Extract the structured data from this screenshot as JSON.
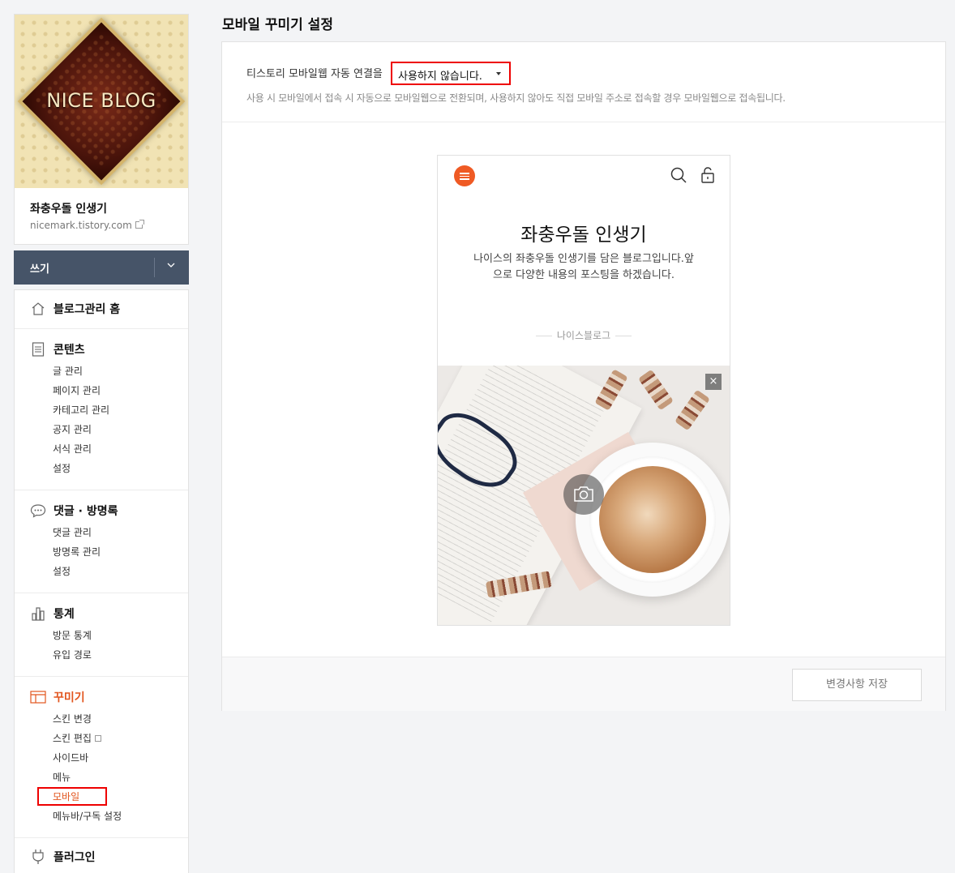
{
  "profile": {
    "logo_text": "NICE BLOG",
    "blog_name": "좌충우돌 인생기",
    "blog_url": "nicemark.tistory.com"
  },
  "write_button": {
    "label": "쓰기"
  },
  "sidebar": {
    "home": {
      "label": "블로그관리 홈",
      "icon": "home-icon"
    },
    "contents": {
      "label": "콘텐츠",
      "icon": "document-icon",
      "items": [
        "글 관리",
        "페이지 관리",
        "카테고리 관리",
        "공지 관리",
        "서식 관리",
        "설정"
      ]
    },
    "comments": {
      "label": "댓글 · 방명록",
      "icon": "speech-bubble-icon",
      "items": [
        "댓글 관리",
        "방명록 관리",
        "설정"
      ]
    },
    "stats": {
      "label": "통계",
      "icon": "bar-chart-icon",
      "items": [
        "방문 통계",
        "유입 경로"
      ]
    },
    "decorate": {
      "label": "꾸미기",
      "icon": "layout-icon",
      "items": [
        "스킨 변경",
        "스킨 편집",
        "사이드바",
        "메뉴",
        "모바일",
        "메뉴바/구독 설정"
      ],
      "selected_item": "모바일"
    },
    "plugin": {
      "label": "플러그인",
      "icon": "plug-icon"
    }
  },
  "page": {
    "title": "모바일 꾸미기 설정",
    "setting_label": "티스토리 모바일웹 자동 연결을",
    "select_value": "사용하지 않습니다.",
    "description": "사용 시 모바일에서 접속 시 자동으로 모바일웹으로 전환되며, 사용하지 않아도 직접 모바일 주소로 접속할 경우 모바일웹으로 접속됩니다.",
    "save_label": "변경사항 저장"
  },
  "preview": {
    "title": "좌충우돌 인생기",
    "description": "나이스의 좌충우돌 인생기를 담은 블로그입니다.앞으로 다양한 내용의 포스팅을 하겠습니다.",
    "author": "나이스블로그",
    "close_label": "×"
  },
  "colors": {
    "accent": "#ef5a24",
    "write_bar": "#465468",
    "highlight": "#ee0000"
  }
}
